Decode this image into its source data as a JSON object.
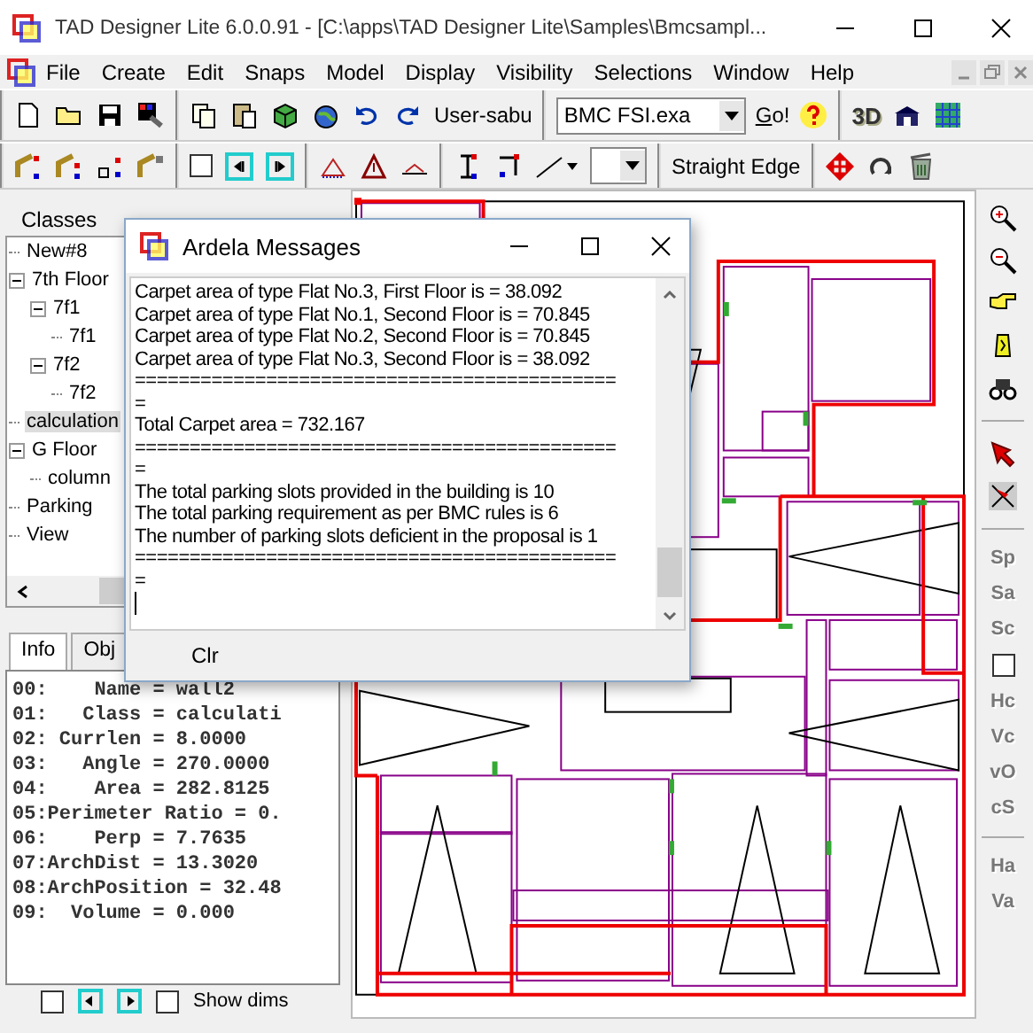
{
  "window": {
    "title": "TAD Designer Lite  6.0.0.91 - [C:\\apps\\TAD Designer Lite\\Samples\\Bmcsampl..."
  },
  "menu": [
    "File",
    "Create",
    "Edit",
    "Snaps",
    "Model",
    "Display",
    "Visibility",
    "Selections",
    "Window",
    "Help"
  ],
  "toolbar_1": {
    "user_button": "User-sabu",
    "file_combo": {
      "value": "BMC FSI.exa"
    },
    "go_button": "Go!",
    "view_3d_button": "3D"
  },
  "toolbar_2": {
    "checkbox": {
      "checked": false
    },
    "edge_mode_button": "Straight Edge"
  },
  "classes_panel": {
    "title": "Classes",
    "tree": [
      {
        "label": "New#8",
        "selected": false
      },
      {
        "label": "7th Floor",
        "selected": false,
        "expanded": true,
        "children": [
          {
            "label": "7f1",
            "selected": false,
            "expanded": true,
            "children": [
              {
                "label": "7f1",
                "selected": false
              }
            ]
          },
          {
            "label": "7f2",
            "selected": false,
            "expanded": true,
            "children": [
              {
                "label": "7f2",
                "selected": false
              }
            ]
          }
        ]
      },
      {
        "label": "calculation",
        "selected": true
      },
      {
        "label": "G Floor",
        "selected": false,
        "expanded": true,
        "children": [
          {
            "label": "column",
            "selected": false
          }
        ]
      },
      {
        "label": "Parking",
        "selected": false
      },
      {
        "label": "View",
        "selected": false
      }
    ]
  },
  "info_panel": {
    "tabs": [
      {
        "label": "Info",
        "selected": true
      },
      {
        "label": "Obj",
        "selected": false
      }
    ],
    "lines": [
      "00:    Name = wall2",
      "01:   Class = calculati",
      "02: Currlen = 8.0000",
      "03:   Angle = 270.0000",
      "04:    Area = 282.8125",
      "05:Perimeter Ratio = 0.",
      "06:    Perp = 7.7635",
      "07:ArchDist = 13.3020",
      "08:ArchPosition = 32.48",
      "09:  Volume = 0.000"
    ],
    "checkbox": {
      "checked": false
    },
    "show_dims": {
      "label": "Show dims",
      "checked": false
    }
  },
  "messages_window": {
    "title": "Ardela Messages",
    "lines": [
      "Carpet area of type Flat No.3, First Floor is = 38.092",
      "Carpet area of type Flat No.1, Second Floor is = 70.845",
      "Carpet area of type Flat No.2, Second Floor is = 70.845",
      "Carpet area of type Flat No.3, Second Floor is = 38.092",
      "============================================",
      "=",
      "Total Carpet area = 732.167",
      "============================================",
      "=",
      "The total parking slots provided in the building is 10",
      "The total parking requirement as per BMC rules is 6",
      "The number of parking slots deficient in the proposal is 1",
      "============================================",
      "="
    ],
    "clear_button": "Clr"
  },
  "right_toolbar": {
    "buttons_top": [
      "Sp",
      "Sa",
      "Sc"
    ],
    "checkbox": {
      "checked": false
    },
    "buttons_middle": [
      "Hc",
      "Vc",
      "vO",
      "cS"
    ],
    "buttons_bottom": [
      "Ha",
      "Va"
    ]
  }
}
